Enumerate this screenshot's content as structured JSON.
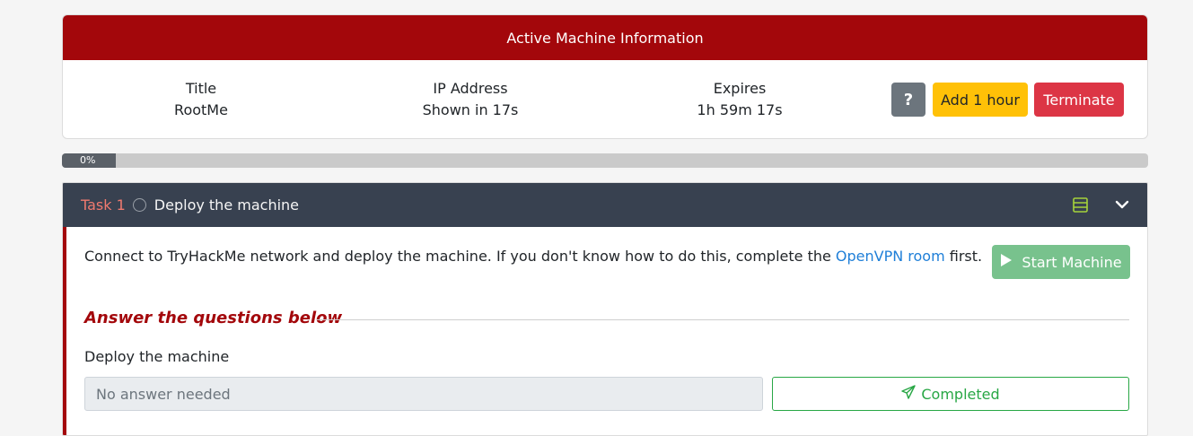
{
  "machine": {
    "header": "Active Machine Information",
    "title_label": "Title",
    "title_value": "RootMe",
    "ip_label": "IP Address",
    "ip_value": "Shown in 17s",
    "expires_label": "Expires",
    "expires_value": "1h 59m 17s",
    "help_label": "?",
    "add_hour_label": "Add 1 hour",
    "terminate_label": "Terminate"
  },
  "progress": {
    "label": "0%",
    "value": 0
  },
  "task": {
    "number": "Task 1",
    "title": "Deploy the machine",
    "description_before": "Connect to TryHackMe network and deploy the machine. If you don't know how to do this, complete the ",
    "description_link": "OpenVPN room",
    "description_after": " first.",
    "start_label": "Start Machine",
    "answer_heading": "Answer the questions below",
    "question": "Deploy the machine",
    "answer_placeholder": "No answer needed",
    "completed_label": "Completed"
  },
  "colors": {
    "header_red": "#a3070b",
    "task_header": "#384150",
    "warning": "#ffc107",
    "danger": "#dc3545",
    "success": "#28a745",
    "start_button": "#78c28d",
    "link": "#1f7fd8"
  },
  "icons": [
    "list-icon",
    "chevron-down-icon",
    "play-icon",
    "paper-plane-icon",
    "circle-icon"
  ]
}
